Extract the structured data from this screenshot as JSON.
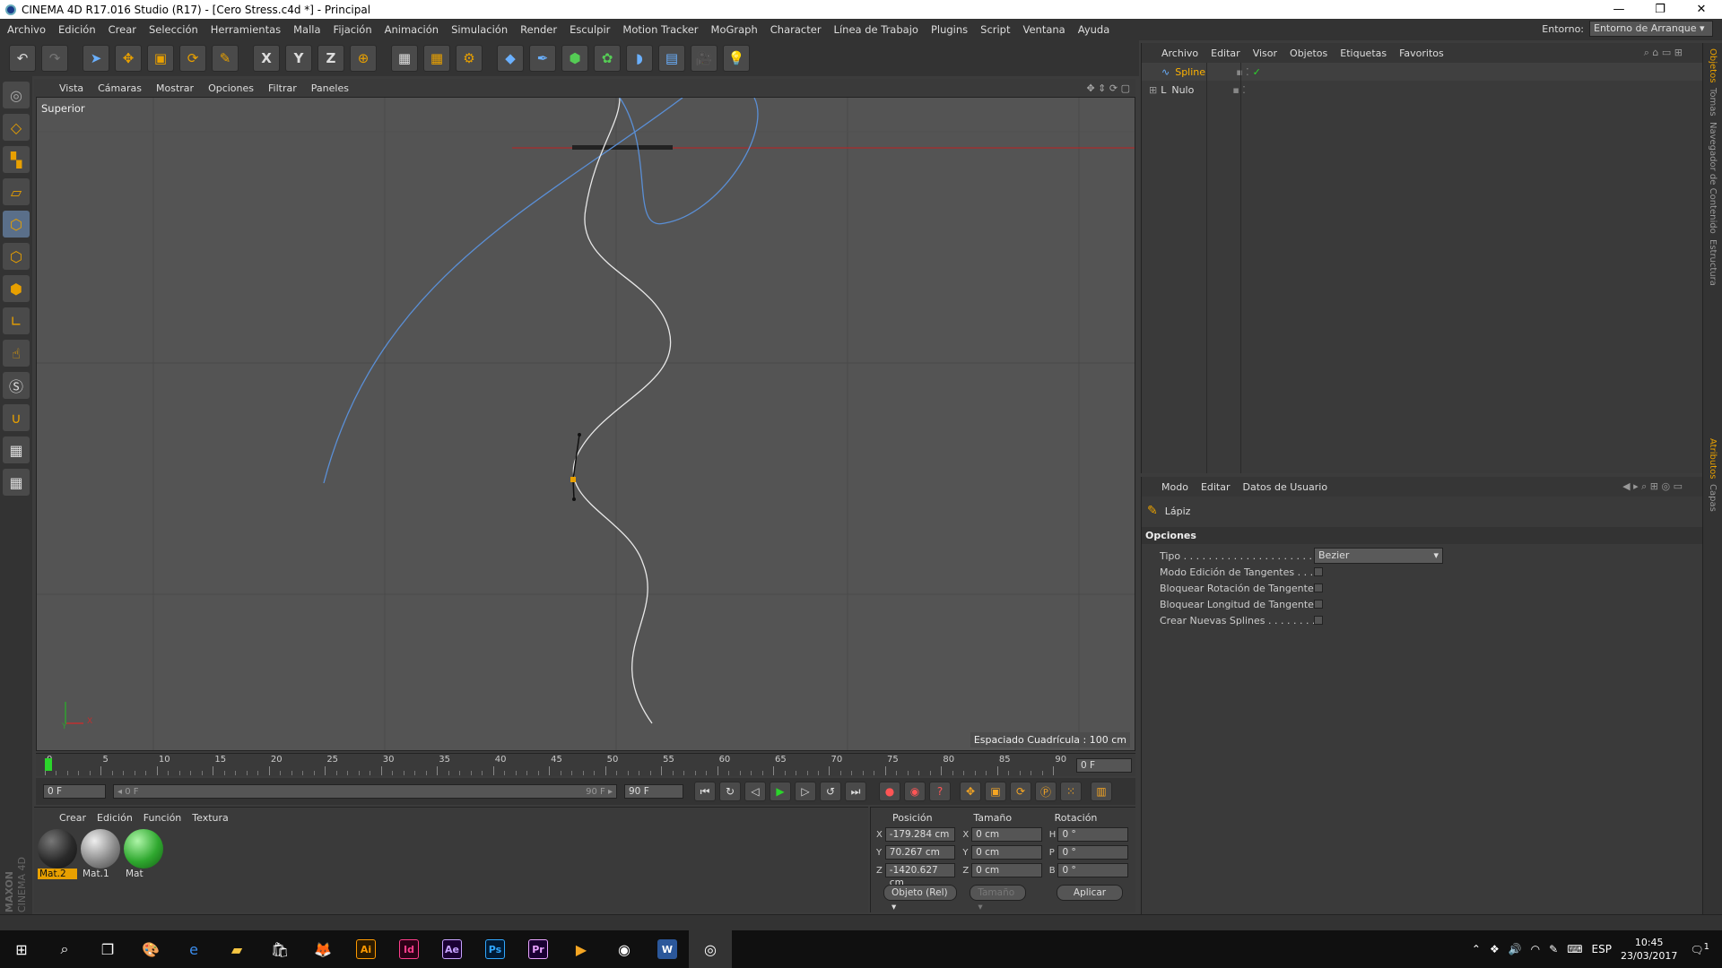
{
  "window": {
    "title": "CINEMA 4D R17.016 Studio (R17) - [Cero Stress.c4d *] - Principal",
    "minimize": "—",
    "restore": "❐",
    "close": "✕"
  },
  "menubar": {
    "items": [
      "Archivo",
      "Edición",
      "Crear",
      "Selección",
      "Herramientas",
      "Malla",
      "Fijación",
      "Animación",
      "Simulación",
      "Render",
      "Esculpir",
      "Motion Tracker",
      "MoGraph",
      "Character",
      "Línea de Trabajo",
      "Plugins",
      "Script",
      "Ventana",
      "Ayuda"
    ],
    "env_label": "Entorno:",
    "env_value": "Entorno de Arranque"
  },
  "toolbar": {
    "icons": [
      "undo-icon",
      "redo-icon",
      "select-arrow-icon",
      "move-icon",
      "scale-icon",
      "rotate-icon",
      "pen-tool-icon",
      "x-axis-icon",
      "y-axis-icon",
      "z-axis-icon",
      "world-coords-icon",
      "render-view-icon",
      "render-picture-icon",
      "render-settings-icon",
      "cube-icon",
      "spline-pen-icon",
      "subdivision-icon",
      "mograph-cloner-icon",
      "deformer-icon",
      "floor-icon",
      "camera-icon",
      "light-icon"
    ],
    "axis_x": "X",
    "axis_y": "Y",
    "axis_z": "Z"
  },
  "viewport": {
    "menu": [
      "Vista",
      "Cámaras",
      "Mostrar",
      "Opciones",
      "Filtrar",
      "Paneles"
    ],
    "label": "Superior",
    "grid_spacing": "Espaciado Cuadrícula : 100 cm",
    "axis_x": "X",
    "axis_y": "Y"
  },
  "timeline": {
    "ticks": [
      "0",
      "5",
      "10",
      "15",
      "20",
      "25",
      "30",
      "35",
      "40",
      "45",
      "50",
      "55",
      "60",
      "65",
      "70",
      "75",
      "80",
      "85",
      "90"
    ],
    "current_frame_box": "0 F",
    "start_frame": "0 F",
    "range_start": "◂ 0 F",
    "range_end": "90 F ▸",
    "end_frame": "90 F"
  },
  "materials": {
    "menu": [
      "Crear",
      "Edición",
      "Función",
      "Textura"
    ],
    "items": [
      {
        "name": "Mat.2",
        "color": "#2a2a2a",
        "selected": true
      },
      {
        "name": "Mat.1",
        "color": "#8a8a8a",
        "selected": false
      },
      {
        "name": "Mat",
        "color": "#2fa82f",
        "selected": false
      }
    ]
  },
  "coords": {
    "headers": [
      "Posición",
      "Tamaño",
      "Rotación"
    ],
    "rows": [
      {
        "axis": "X",
        "pos": "-179.284 cm",
        "size_axis": "X",
        "size": "0 cm",
        "rot_axis": "H",
        "rot": "0 °"
      },
      {
        "axis": "Y",
        "pos": "70.267 cm",
        "size_axis": "Y",
        "size": "0 cm",
        "rot_axis": "P",
        "rot": "0 °"
      },
      {
        "axis": "Z",
        "pos": "-1420.627 cm",
        "size_axis": "Z",
        "size": "0 cm",
        "rot_axis": "B",
        "rot": "0 °"
      }
    ],
    "mode": "Objeto (Rel)",
    "size_mode": "Tamaño",
    "apply": "Aplicar"
  },
  "objects": {
    "menu": [
      "Archivo",
      "Editar",
      "Visor",
      "Objetos",
      "Etiquetas",
      "Favoritos"
    ],
    "items": [
      {
        "name": "Spline",
        "selected": true
      },
      {
        "name": "Nulo",
        "selected": false
      }
    ]
  },
  "attributes": {
    "menu": [
      "Modo",
      "Editar",
      "Datos de Usuario"
    ],
    "tool": "Lápiz",
    "section": "Opciones",
    "tipo_label": "Tipo . . . . . . . . . . . . . . . . . . . . . .",
    "tipo_value": "Bezier",
    "options": [
      "Modo Edición de Tangentes . . . .",
      "Bloquear Rotación de Tangentes",
      "Bloquear Longitud de Tangentes",
      "Crear Nuevas Splines . . . . . . . . . ."
    ]
  },
  "side_tabs": [
    "Objetos",
    "Tomas",
    "Navegador de Contenido",
    "Estructura"
  ],
  "side_tabs_lower": [
    "Atributos",
    "Capas"
  ],
  "maxon": {
    "brand": "MAXON",
    "product": "CINEMA 4D"
  },
  "taskbar": {
    "apps": [
      {
        "label": "Ai",
        "bg": "#2b1a00",
        "fg": "#ff9a00"
      },
      {
        "label": "Id",
        "bg": "#2b0016",
        "fg": "#ff3d8b"
      },
      {
        "label": "Ae",
        "bg": "#1a0033",
        "fg": "#c7a3ff"
      },
      {
        "label": "Ps",
        "bg": "#001a33",
        "fg": "#31a8ff"
      },
      {
        "label": "Pr",
        "bg": "#1a0033",
        "fg": "#e8a3ff"
      }
    ],
    "lang": "ESP",
    "time": "10:45",
    "date": "23/03/2017",
    "notification_count": "1"
  }
}
